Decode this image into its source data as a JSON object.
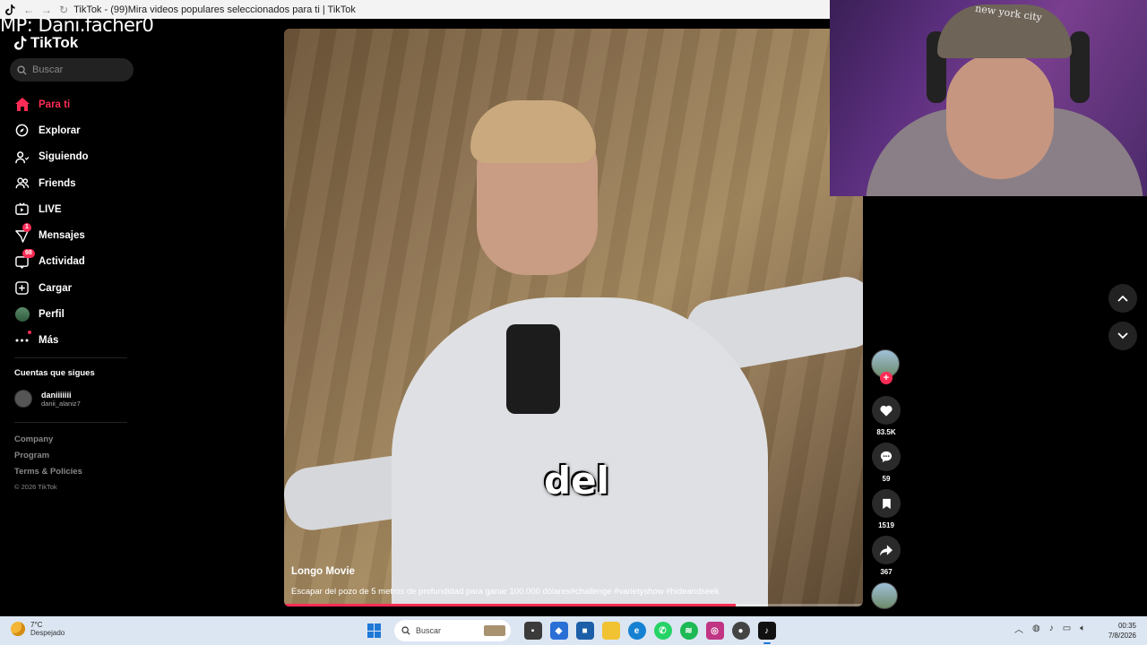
{
  "browser": {
    "title": "TikTok - (99)Mira videos populares seleccionados para ti | TikTok"
  },
  "stream_overlay": {
    "text": "MP: Dani.facher0"
  },
  "sidebar": {
    "logo": "TikTok",
    "search_placeholder": "Buscar",
    "items": [
      {
        "label": "Para ti",
        "icon": "home-icon",
        "active": true
      },
      {
        "label": "Explorar",
        "icon": "compass-icon"
      },
      {
        "label": "Siguiendo",
        "icon": "following-icon"
      },
      {
        "label": "Friends",
        "icon": "friends-icon"
      },
      {
        "label": "LIVE",
        "icon": "live-icon"
      },
      {
        "label": "Mensajes",
        "icon": "messages-icon",
        "badge": "1"
      },
      {
        "label": "Actividad",
        "icon": "activity-icon",
        "badge": "98"
      },
      {
        "label": "Cargar",
        "icon": "upload-icon"
      },
      {
        "label": "Perfil",
        "icon": "profile-avatar-icon"
      },
      {
        "label": "Más",
        "icon": "more-icon"
      }
    ],
    "following_title": "Cuentas que sigues",
    "following": [
      {
        "name": "daniiiiiii",
        "username": "danii_alaniz7"
      }
    ],
    "footer": {
      "links": [
        "Company",
        "Program",
        "Terms & Policies"
      ],
      "copyright": "© 2026 TikTok"
    }
  },
  "video": {
    "caption_word": "del",
    "author": "Longo Movie",
    "description": "Escapar del pozo de 5 metros de profundidad para ganar 100.000 dólares#challenge #varietyshow #hideandseek",
    "progress": 0.78
  },
  "actions": {
    "likes": "83.5K",
    "comments": "59",
    "saves": "1519",
    "shares": "367"
  },
  "webcam": {
    "cap_text": "new york city"
  },
  "taskbar": {
    "weather_temp": "7°C",
    "weather_desc": "Despejado",
    "search_placeholder": "Buscar",
    "time": "00:35",
    "date": "7/8/2026"
  },
  "colors": {
    "accent": "#fe2c55",
    "background": "#000000",
    "taskbar": "#dce6f2"
  }
}
